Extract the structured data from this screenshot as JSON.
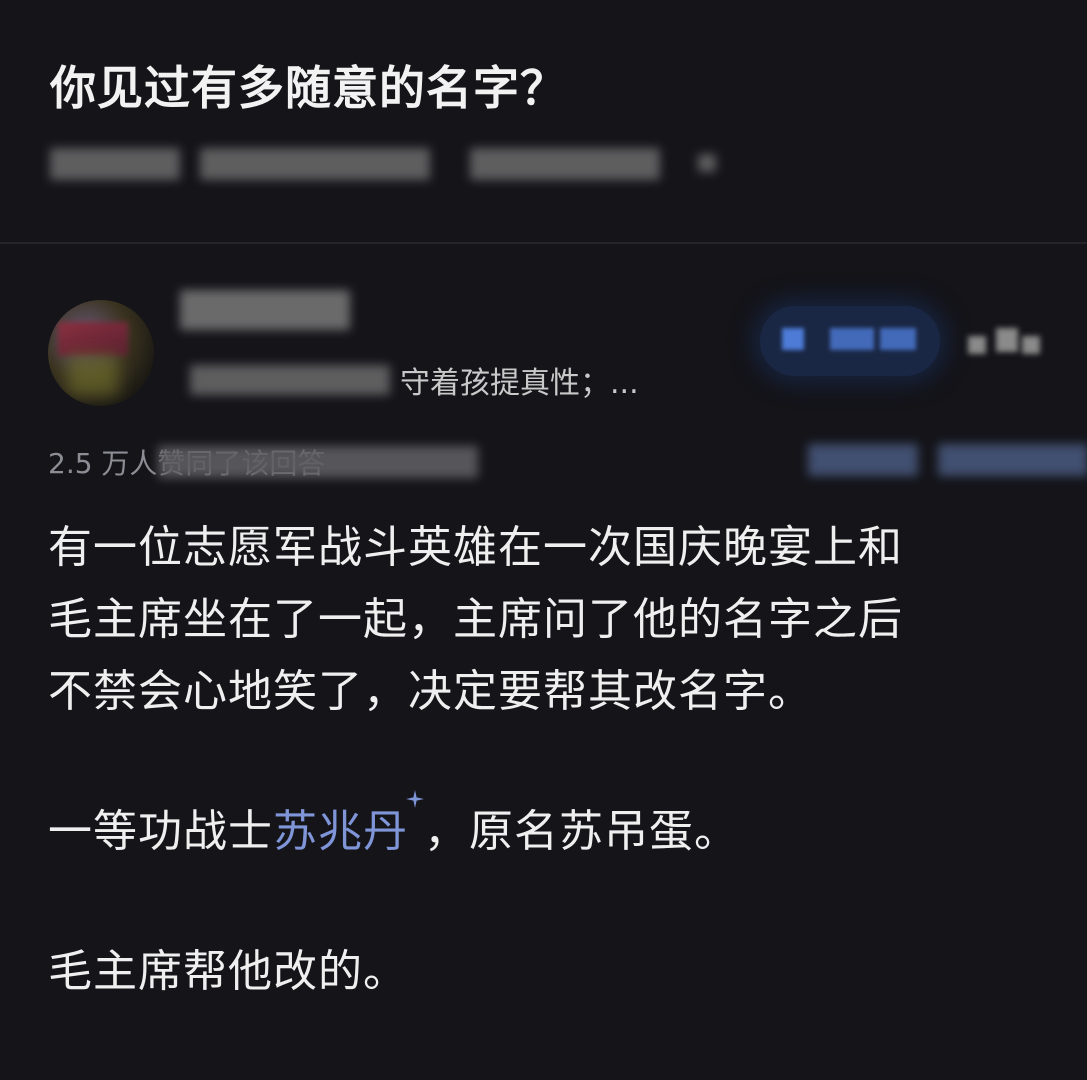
{
  "question": {
    "title": "你见过有多随意的名字？"
  },
  "answer": {
    "author_bio_visible": "守着孩提真性；...",
    "stats_prefix": "2.5 万人赞同了该回答",
    "paragraphs": {
      "p1_line1": "有一位志愿军战斗英雄在一次国庆晚宴上和",
      "p1_line2": "毛主席坐在了一起，主席问了他的名字之后",
      "p1_line3": "不禁会心地笑了，决定要帮其改名字。",
      "p2_before": "一等功战士",
      "p2_link": "苏兆丹",
      "p2_after": "，原名苏吊蛋。",
      "p3": "毛主席帮他改的。"
    }
  },
  "colors": {
    "background": "#141419",
    "text": "#efefef",
    "link": "#7f95d8",
    "muted": "#8d8d95",
    "follow_bg": "#1a2744"
  },
  "icons": {
    "sparkle": "sparkle-icon",
    "more": "more-icon"
  }
}
